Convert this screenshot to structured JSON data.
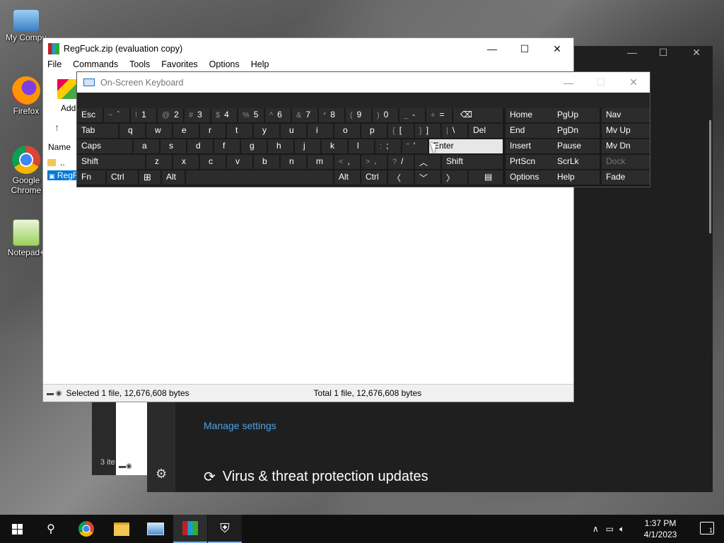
{
  "desktop": {
    "icons": [
      {
        "label": "My Compu",
        "icon": "computer-icon"
      },
      {
        "label": "Firefox",
        "icon": "firefox-icon"
      },
      {
        "label": "Google Chrome",
        "icon": "chrome-icon"
      },
      {
        "label": "Notepad+",
        "icon": "notepad-plus-icon"
      }
    ]
  },
  "defender": {
    "manage_link": "Manage settings",
    "virus_updates": "Virus & threat protection updates",
    "settings_icon": "gear-icon"
  },
  "back_explorer": {
    "status": "3 ite"
  },
  "winrar": {
    "title": "RegFuck.zip (evaluation copy)",
    "menu": [
      "File",
      "Commands",
      "Tools",
      "Favorites",
      "Options",
      "Help"
    ],
    "add_label": "Add",
    "column_name": "Name",
    "rows": [
      "..",
      "RegF"
    ],
    "status_selected": "Selected 1 file, 12,676,608 bytes",
    "status_total": "Total 1 file, 12,676,608 bytes"
  },
  "osk": {
    "title": "On-Screen Keyboard",
    "keys": {
      "esc": "Esc",
      "tab": "Tab",
      "caps": "Caps",
      "shift_l": "Shift",
      "fn": "Fn",
      "ctrl_l": "Ctrl",
      "alt_l": "Alt",
      "alt_r": "Alt",
      "ctrl_r": "Ctrl",
      "del": "Del",
      "enter": "Enter",
      "shift_r": "Shift",
      "home": "Home",
      "pgup": "PgUp",
      "nav": "Nav",
      "end": "End",
      "pgdn": "PgDn",
      "mvup": "Mv Up",
      "insert": "Insert",
      "pause": "Pause",
      "mvdn": "Mv Dn",
      "prtscn": "PrtScn",
      "scrlk": "ScrLk",
      "dock": "Dock",
      "options": "Options",
      "help": "Help",
      "fade": "Fade"
    },
    "row1": [
      {
        "s": "~",
        "m": "`"
      },
      {
        "s": "!",
        "m": "1"
      },
      {
        "s": "@",
        "m": "2"
      },
      {
        "s": "#",
        "m": "3"
      },
      {
        "s": "$",
        "m": "4"
      },
      {
        "s": "%",
        "m": "5"
      },
      {
        "s": "^",
        "m": "6"
      },
      {
        "s": "&",
        "m": "7"
      },
      {
        "s": "*",
        "m": "8"
      },
      {
        "s": "(",
        "m": "9"
      },
      {
        "s": ")",
        "m": "0"
      },
      {
        "s": "_",
        "m": "-"
      },
      {
        "s": "+",
        "m": "="
      }
    ],
    "row2": [
      "q",
      "w",
      "e",
      "r",
      "t",
      "y",
      "u",
      "i",
      "o",
      "p"
    ],
    "row2_sym": [
      {
        "s": "{",
        "m": "["
      },
      {
        "s": "}",
        "m": "]"
      },
      {
        "s": "|",
        "m": "\\"
      }
    ],
    "row3": [
      "a",
      "s",
      "d",
      "f",
      "g",
      "h",
      "j",
      "k",
      "l"
    ],
    "row3_sym": [
      {
        "s": ":",
        "m": ";"
      },
      {
        "s": "\"",
        "m": "'"
      }
    ],
    "row4": [
      "z",
      "x",
      "c",
      "v",
      "b",
      "n",
      "m"
    ],
    "row4_sym": [
      {
        "s": "<",
        "m": ","
      },
      {
        "s": ">",
        "m": "."
      },
      {
        "s": "?",
        "m": "/"
      }
    ]
  },
  "taskbar": {
    "time": "1:37 PM",
    "date": "4/1/2023",
    "notification_count": "1"
  }
}
